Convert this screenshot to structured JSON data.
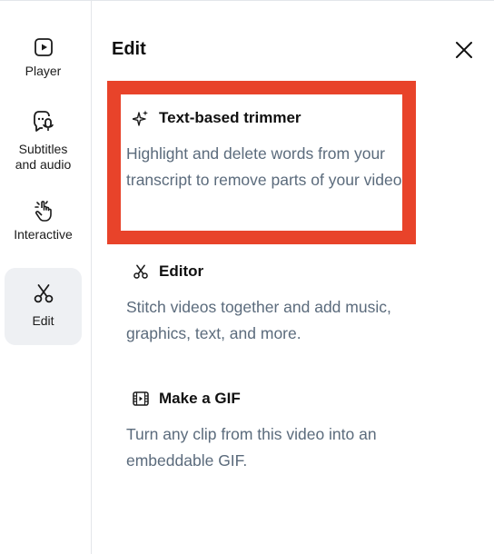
{
  "sidebar": {
    "items": [
      {
        "label": "Player",
        "icon": "play-icon",
        "active": false
      },
      {
        "label": "Subtitles\nand audio",
        "icon": "subtitles-audio-icon",
        "active": false
      },
      {
        "label": "Interactive",
        "icon": "tap-hand-icon",
        "active": false
      },
      {
        "label": "Edit",
        "icon": "scissors-icon",
        "active": true
      }
    ]
  },
  "panel": {
    "title": "Edit",
    "options": [
      {
        "title": "Text-based trimmer",
        "icon": "sparkle-icon",
        "description": "Highlight and delete words from your transcript to remove parts of your video."
      },
      {
        "title": "Editor",
        "icon": "scissors-icon",
        "description": "Stitch videos together and add music, graphics, text, and more."
      },
      {
        "title": "Make a GIF",
        "icon": "film-icon",
        "description": "Turn any clip from this video into an embeddable GIF."
      }
    ]
  },
  "colors": {
    "highlight": "#e8432a",
    "description_text": "#5b6b7c",
    "active_nav_bg": "#eef0f3"
  }
}
